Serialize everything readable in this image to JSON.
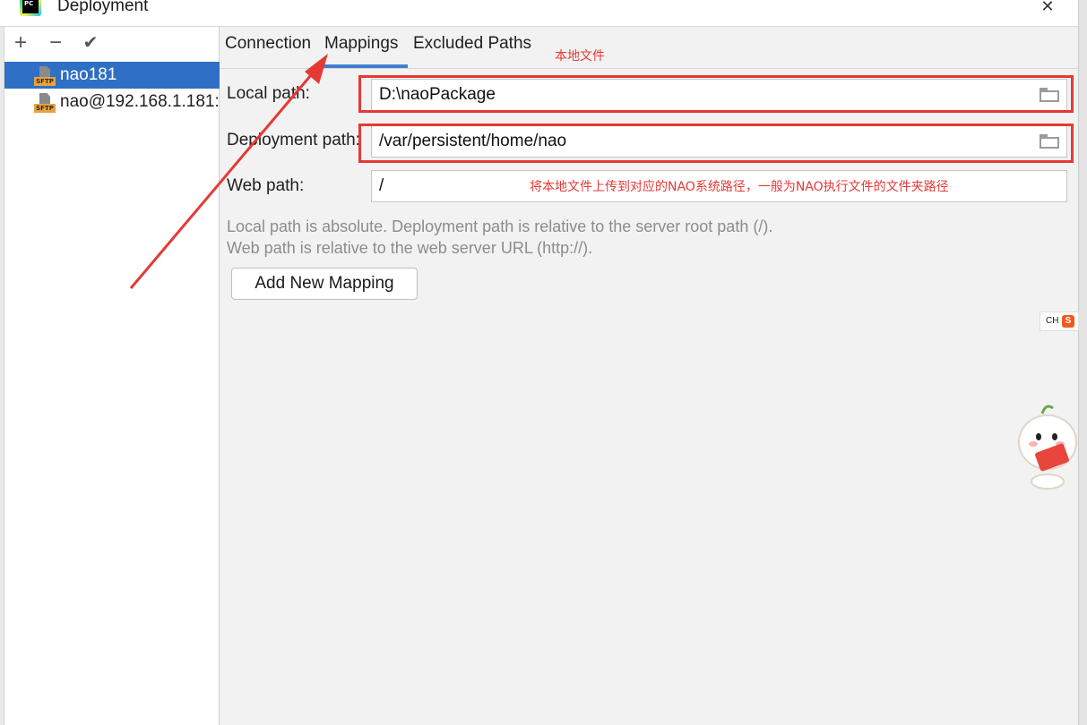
{
  "window": {
    "title": "Deployment",
    "close_glyph": "✕"
  },
  "app_logo_text": "PC",
  "left_toolbar": {
    "add": "+",
    "remove": "−",
    "check": "✔"
  },
  "servers": [
    {
      "name": "nao181",
      "icon": "sftp-icon",
      "icon_label": "SFTP",
      "selected": true
    },
    {
      "name": "nao@192.168.1.181:",
      "icon": "sftp-icon",
      "icon_label": "SFTP",
      "selected": false
    }
  ],
  "tabs": [
    {
      "label": "Connection",
      "active": false
    },
    {
      "label": "Mappings",
      "active": true
    },
    {
      "label": "Excluded Paths",
      "active": false
    }
  ],
  "mappings": {
    "local_path_label": "Local path:",
    "local_path_value": "D:\\naoPackage",
    "deployment_path_label": "Deployment path:",
    "deployment_path_value": "/var/persistent/home/nao",
    "web_path_label": "Web path:",
    "web_path_value": "/",
    "hint_line1": "Local path is absolute. Deployment path is relative to the server root path (/).",
    "hint_line2": "Web path is relative to the web server URL (http://).",
    "add_mapping_button": "Add New Mapping"
  },
  "annotations": {
    "local_file_note": "本地文件",
    "upload_note": "将本地文件上传到对应的NAO系统路径，一般为NAO执行文件的文件夹路径"
  },
  "ime": {
    "text": "CH",
    "logo": "S"
  },
  "colors": {
    "selection": "#2f6fc5",
    "tab_underline": "#3f7fcf",
    "annotation_red": "#e53935"
  }
}
